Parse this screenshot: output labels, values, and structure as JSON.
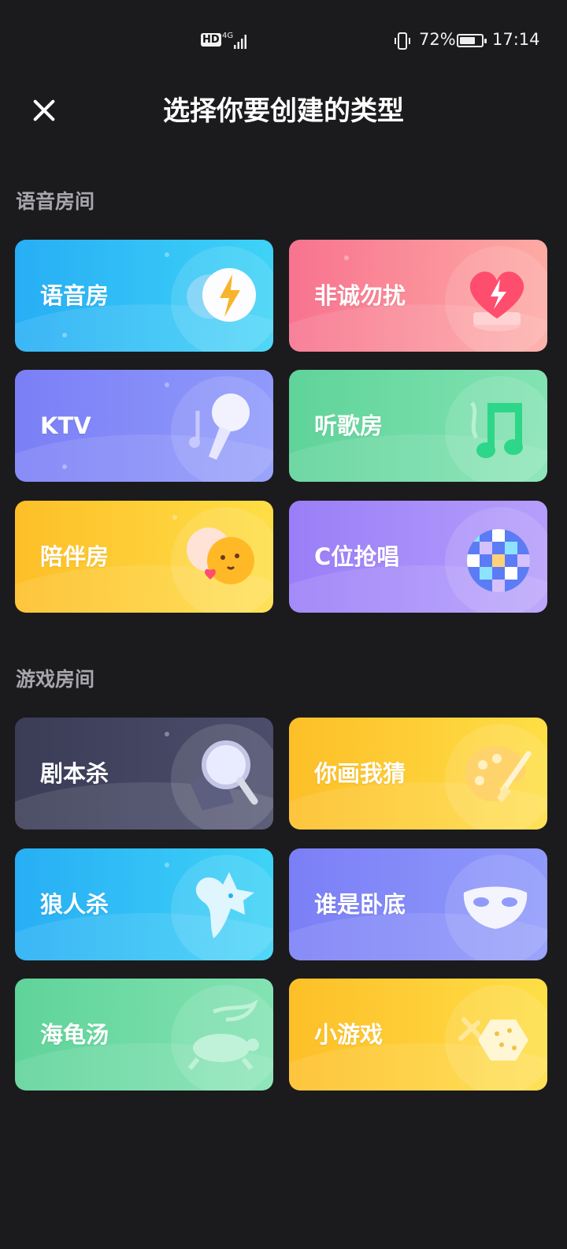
{
  "status_bar": {
    "hd": "HD",
    "network": "4G",
    "battery_percent": "72%",
    "battery_level": 0.72,
    "time": "17:14"
  },
  "header": {
    "title": "选择你要创建的类型"
  },
  "sections": [
    {
      "title": "语音房间",
      "cards": [
        {
          "label": "语音房",
          "icon": "lightning-chat-icon",
          "color": "#27aef5"
        },
        {
          "label": "非诚勿扰",
          "icon": "heart-icon",
          "color": "#f8738f"
        },
        {
          "label": "KTV",
          "icon": "microphone-icon",
          "color": "#7b7ff6"
        },
        {
          "label": "听歌房",
          "icon": "music-note-icon",
          "color": "#5fd39a"
        },
        {
          "label": "陪伴房",
          "icon": "emoji-faces-icon",
          "color": "#fdbf28"
        },
        {
          "label": "C位抢唱",
          "icon": "disco-ball-icon",
          "color": "#9a7ef8"
        }
      ]
    },
    {
      "title": "游戏房间",
      "cards": [
        {
          "label": "剧本杀",
          "icon": "magnifier-icon",
          "color": "#3b3d57"
        },
        {
          "label": "你画我猜",
          "icon": "palette-icon",
          "color": "#fdbf28"
        },
        {
          "label": "狼人杀",
          "icon": "wolf-icon",
          "color": "#27aef5"
        },
        {
          "label": "谁是卧底",
          "icon": "mask-icon",
          "color": "#7b7ff6"
        },
        {
          "label": "海龟汤",
          "icon": "turtle-icon",
          "color": "#5fd39a"
        },
        {
          "label": "小游戏",
          "icon": "gamepad-hexagon-icon",
          "color": "#fdbf28"
        }
      ]
    }
  ]
}
